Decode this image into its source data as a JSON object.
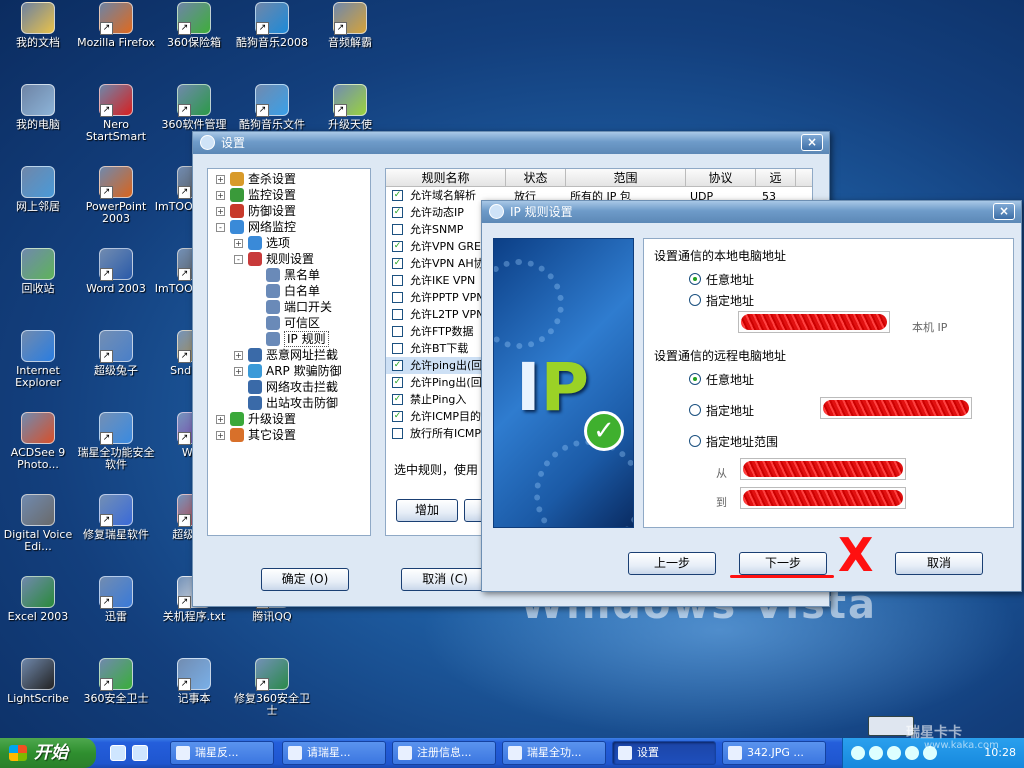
{
  "desktop": {
    "wallpaper_text": "Windows Vista",
    "icons": [
      {
        "label": "我的文档",
        "color": "#e9c24a"
      },
      {
        "label": "Mozilla Firefox",
        "color": "#e06a1e"
      },
      {
        "label": "360保险箱",
        "color": "#3fae3a"
      },
      {
        "label": "酷狗音乐2008",
        "color": "#1d8ad8"
      },
      {
        "label": "音频解霸",
        "color": "#d6a33a"
      },
      {
        "label": "我的电脑",
        "color": "#8db4d8"
      },
      {
        "label": "Nero StartSmart",
        "color": "#d82020"
      },
      {
        "label": "360软件管理",
        "color": "#2c9a48"
      },
      {
        "label": "酷狗音乐文件",
        "color": "#3aa0e8"
      },
      {
        "label": "升级天使",
        "color": "#9ad23e"
      },
      {
        "label": "网上邻居",
        "color": "#4a9ad8"
      },
      {
        "label": "PowerPoint 2003",
        "color": "#d9641c"
      },
      {
        "label": "ImTOO Enco...",
        "color": "#555555"
      },
      {
        "label": "回收站",
        "color": "#5fb35a"
      },
      {
        "label": "Word 2003",
        "color": "#2a5aa8"
      },
      {
        "label": "ImTOO Enco...",
        "color": "#555555"
      },
      {
        "label": "Internet Explorer",
        "color": "#2a7de0"
      },
      {
        "label": "超级兔子",
        "color": "#4a7fc8"
      },
      {
        "label": "SndMa...",
        "color": "#b08a3a"
      },
      {
        "label": "ACDSee 9 Photo...",
        "color": "#d8502a"
      },
      {
        "label": "瑞星全功能安全软件",
        "color": "#3a8ae0"
      },
      {
        "label": "Wi...",
        "color": "#7a3aa8"
      },
      {
        "label": "Digital Voice Edi...",
        "color": "#6a6a6a"
      },
      {
        "label": "修复瑞星软件",
        "color": "#3a6ad8"
      },
      {
        "label": "超级解...",
        "color": "#c83a3a"
      },
      {
        "label": "Excel 2003",
        "color": "#2a8a3a"
      },
      {
        "label": "迅雷",
        "color": "#3a7ad8"
      },
      {
        "label": "关机程序.txt",
        "color": "#e8e8e8"
      },
      {
        "label": "腾讯QQ",
        "color": "#3aa0e8"
      },
      {
        "label": "LightScribe",
        "color": "#222222"
      },
      {
        "label": "360安全卫士",
        "color": "#3aae3a"
      },
      {
        "label": "记事本",
        "color": "#7ab0e8"
      },
      {
        "label": "修复360安全卫士",
        "color": "#2a8a4a"
      }
    ]
  },
  "settings_window": {
    "title": "设置",
    "tree": [
      {
        "label": "查杀设置",
        "level": 0,
        "expander": "+",
        "icon_color": "#d89a2a"
      },
      {
        "label": "监控设置",
        "level": 0,
        "expander": "+",
        "icon_color": "#3a9a3a"
      },
      {
        "label": "防御设置",
        "level": 0,
        "expander": "+",
        "icon_color": "#c83a2a"
      },
      {
        "label": "网络监控",
        "level": 0,
        "expander": "-",
        "icon_color": "#3a8ad8"
      },
      {
        "label": "选项",
        "level": 1,
        "expander": "+",
        "icon_color": "#3a8ad8"
      },
      {
        "label": "规则设置",
        "level": 1,
        "expander": "-",
        "icon_color": "#c83a3a"
      },
      {
        "label": "黑名单",
        "level": 2,
        "expander": "",
        "icon_color": "#6a8ab8"
      },
      {
        "label": "白名单",
        "level": 2,
        "expander": "",
        "icon_color": "#6a8ab8"
      },
      {
        "label": "端口开关",
        "level": 2,
        "expander": "",
        "icon_color": "#6a8ab8"
      },
      {
        "label": "可信区",
        "level": 2,
        "expander": "",
        "icon_color": "#6a8ab8"
      },
      {
        "label": "IP 规则",
        "level": 2,
        "expander": "",
        "icon_color": "#6a8ab8",
        "selected": true
      },
      {
        "label": "恶意网址拦截",
        "level": 1,
        "expander": "+",
        "icon_color": "#3a6aa8"
      },
      {
        "label": "ARP 欺骗防御",
        "level": 1,
        "expander": "+",
        "icon_color": "#3a9ad8"
      },
      {
        "label": "网络攻击拦截",
        "level": 1,
        "expander": "",
        "icon_color": "#3a6aa8"
      },
      {
        "label": "出站攻击防御",
        "level": 1,
        "expander": "",
        "icon_color": "#3a6aa8"
      },
      {
        "label": "升级设置",
        "level": 0,
        "expander": "+",
        "icon_color": "#3aa83a"
      },
      {
        "label": "其它设置",
        "level": 0,
        "expander": "+",
        "icon_color": "#d8702a"
      }
    ],
    "columns": [
      "规则名称",
      "状态",
      "范围",
      "协议",
      "远"
    ],
    "rules": [
      {
        "checked": true,
        "name": "允许域名解析",
        "status": "放行",
        "scope": "所有的 IP 包",
        "protocol": "UDP",
        "port": "53"
      },
      {
        "checked": true,
        "name": "允许动态IP",
        "status": "",
        "scope": "",
        "protocol": "",
        "port": ""
      },
      {
        "checked": false,
        "name": "允许SNMP",
        "status": "",
        "scope": "",
        "protocol": "",
        "port": ""
      },
      {
        "checked": true,
        "name": "允许VPN GRE协",
        "status": "",
        "scope": "",
        "protocol": "",
        "port": ""
      },
      {
        "checked": true,
        "name": "允许VPN AH协",
        "status": "",
        "scope": "",
        "protocol": "",
        "port": ""
      },
      {
        "checked": false,
        "name": "允许IKE VPN",
        "status": "",
        "scope": "",
        "protocol": "",
        "port": ""
      },
      {
        "checked": false,
        "name": "允许PPTP VPN",
        "status": "",
        "scope": "",
        "protocol": "",
        "port": ""
      },
      {
        "checked": false,
        "name": "允许L2TP VPN",
        "status": "",
        "scope": "",
        "protocol": "",
        "port": ""
      },
      {
        "checked": false,
        "name": "允许FTP数据",
        "status": "",
        "scope": "",
        "protocol": "",
        "port": ""
      },
      {
        "checked": false,
        "name": "允许BT下载",
        "status": "",
        "scope": "",
        "protocol": "",
        "port": ""
      },
      {
        "checked": true,
        "name": "允许ping出(回",
        "status": "",
        "scope": "",
        "protocol": "",
        "port": "",
        "selected": true
      },
      {
        "checked": true,
        "name": "允许Ping出(回",
        "status": "",
        "scope": "",
        "protocol": "",
        "port": ""
      },
      {
        "checked": true,
        "name": "禁止Ping入",
        "status": "",
        "scope": "",
        "protocol": "",
        "port": ""
      },
      {
        "checked": true,
        "name": "允许ICMP目的",
        "status": "",
        "scope": "",
        "protocol": "",
        "port": ""
      },
      {
        "checked": false,
        "name": "放行所有ICMP",
        "status": "",
        "scope": "",
        "protocol": "",
        "port": ""
      }
    ],
    "hint": "选中规则，使用",
    "add_label": "增加",
    "ok_label": "确定 (O)",
    "cancel_label": "取消 (C)"
  },
  "ip_dialog": {
    "title": "IP 规则设置",
    "art_letters": [
      "I",
      "P"
    ],
    "local_title": "设置通信的本地电脑地址",
    "local_any": "任意地址",
    "local_specific": "指定地址",
    "local_note": "本机 IP",
    "remote_title": "设置通信的远程电脑地址",
    "remote_any": "任意地址",
    "remote_specific": "指定地址",
    "remote_range": "指定地址范围",
    "from_label": "从",
    "to_label": "到",
    "prev_label": "上一步",
    "next_label": "下一步",
    "cancel_label": "取消",
    "local_selected": "任意地址",
    "remote_selected": "任意地址"
  },
  "taskbar": {
    "start_label": "开始",
    "tasks": [
      "瑞星反...",
      "请瑞星...",
      "注册信息...",
      "瑞星全功...",
      "设置",
      "342.JPG ..."
    ],
    "active_task": "设置",
    "clock": "10:28"
  },
  "watermark": {
    "main": "瑞星卡卡",
    "sub": "www.kaka.com"
  }
}
